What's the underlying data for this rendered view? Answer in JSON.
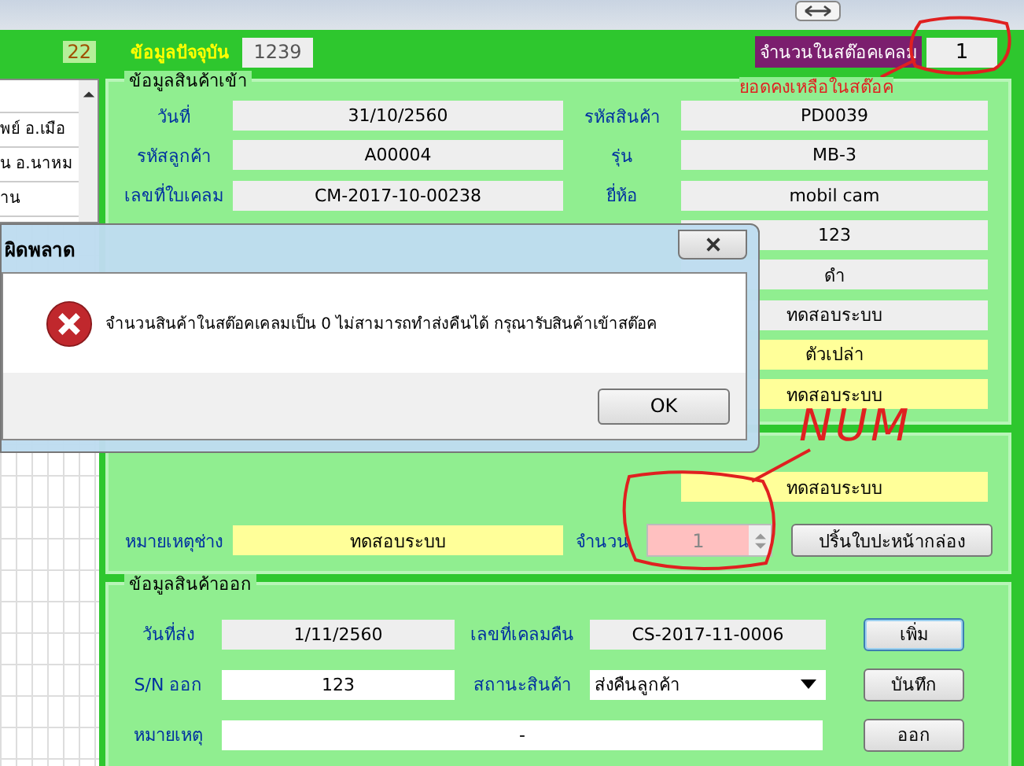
{
  "current": {
    "label": "ข้อมูลปัจจุบัน",
    "value": "1239",
    "badge": "22"
  },
  "stock": {
    "label": "จำนวนในสต๊อคเคลม",
    "value": "1"
  },
  "list": {
    "items": [
      "พย์ อ.เมือ",
      "น อ.นาหม",
      "าน"
    ]
  },
  "incoming": {
    "title": "ข้อมูลสินค้าเข้า",
    "rows": [
      {
        "left": {
          "label": "วันที่",
          "value": "31/10/2560",
          "kind": "readonly"
        },
        "right": {
          "label": "รหัสสินค้า",
          "value": "PD0039",
          "kind": "readonly"
        }
      },
      {
        "left": {
          "label": "รหัสลูกค้า",
          "value": "A00004",
          "kind": "readonly"
        },
        "right": {
          "label": "รุ่น",
          "value": "MB-3",
          "kind": "readonly"
        }
      },
      {
        "left": {
          "label": "เลขที่ใบเคลม",
          "value": "CM-2017-10-00238",
          "kind": "readonly"
        },
        "right": {
          "label": "ยี่ห้อ",
          "value": "mobil cam",
          "kind": "readonly"
        }
      },
      {
        "right": {
          "value": "123",
          "kind": "readonly"
        }
      },
      {
        "right": {
          "value": "ดำ",
          "kind": "readonly"
        }
      },
      {
        "right": {
          "value": "ทดสอบระบบ",
          "kind": "readonly"
        }
      },
      {
        "right": {
          "value": "ตัวเปล่า",
          "kind": "note"
        }
      },
      {
        "right": {
          "value": "ทดสอบระบบ",
          "kind": "note"
        }
      }
    ]
  },
  "test": {
    "top_value": "ทดสอบระบบ",
    "note_label": "หมายเหตุช่าง",
    "note_value": "ทดสอบระบบ",
    "qty_label": "จำนวน",
    "qty_value": "1",
    "print_button": "ปริ้นใบปะหน้ากล่อง"
  },
  "outgoing": {
    "title": "ข้อมูลสินค้าออก",
    "rows": [
      {
        "left": {
          "label": "วันที่ส่ง",
          "value": "1/11/2560",
          "kind": "readonly"
        },
        "right": {
          "label": "เลขที่เคลมคืน",
          "value": "CS-2017-11-0006",
          "kind": "readonly"
        },
        "button": "เพิ่ม"
      },
      {
        "left": {
          "label": "S/N ออก",
          "value": "123",
          "kind": "input"
        },
        "right": {
          "label": "สถานะสินค้า",
          "value": "ส่งคืนลูกค้า",
          "kind": "dropdown"
        },
        "button": "บันทึก"
      },
      {
        "left": {
          "label": "หมายเหตุ",
          "value": "-",
          "kind": "input"
        },
        "button": "ออก"
      }
    ]
  },
  "dialog": {
    "title": "ผิดพลาด",
    "message": "จำนวนสินค้าในสต๊อคเคลมเป็น 0 ไม่สามารถทำส่งคืนได้ กรุณารับสินค้าเข้าสต๊อค",
    "button": "OK"
  },
  "annotations": {
    "stock_note": "ยอดคงเหลือในสต๊อค",
    "qty_note": "NUM"
  }
}
